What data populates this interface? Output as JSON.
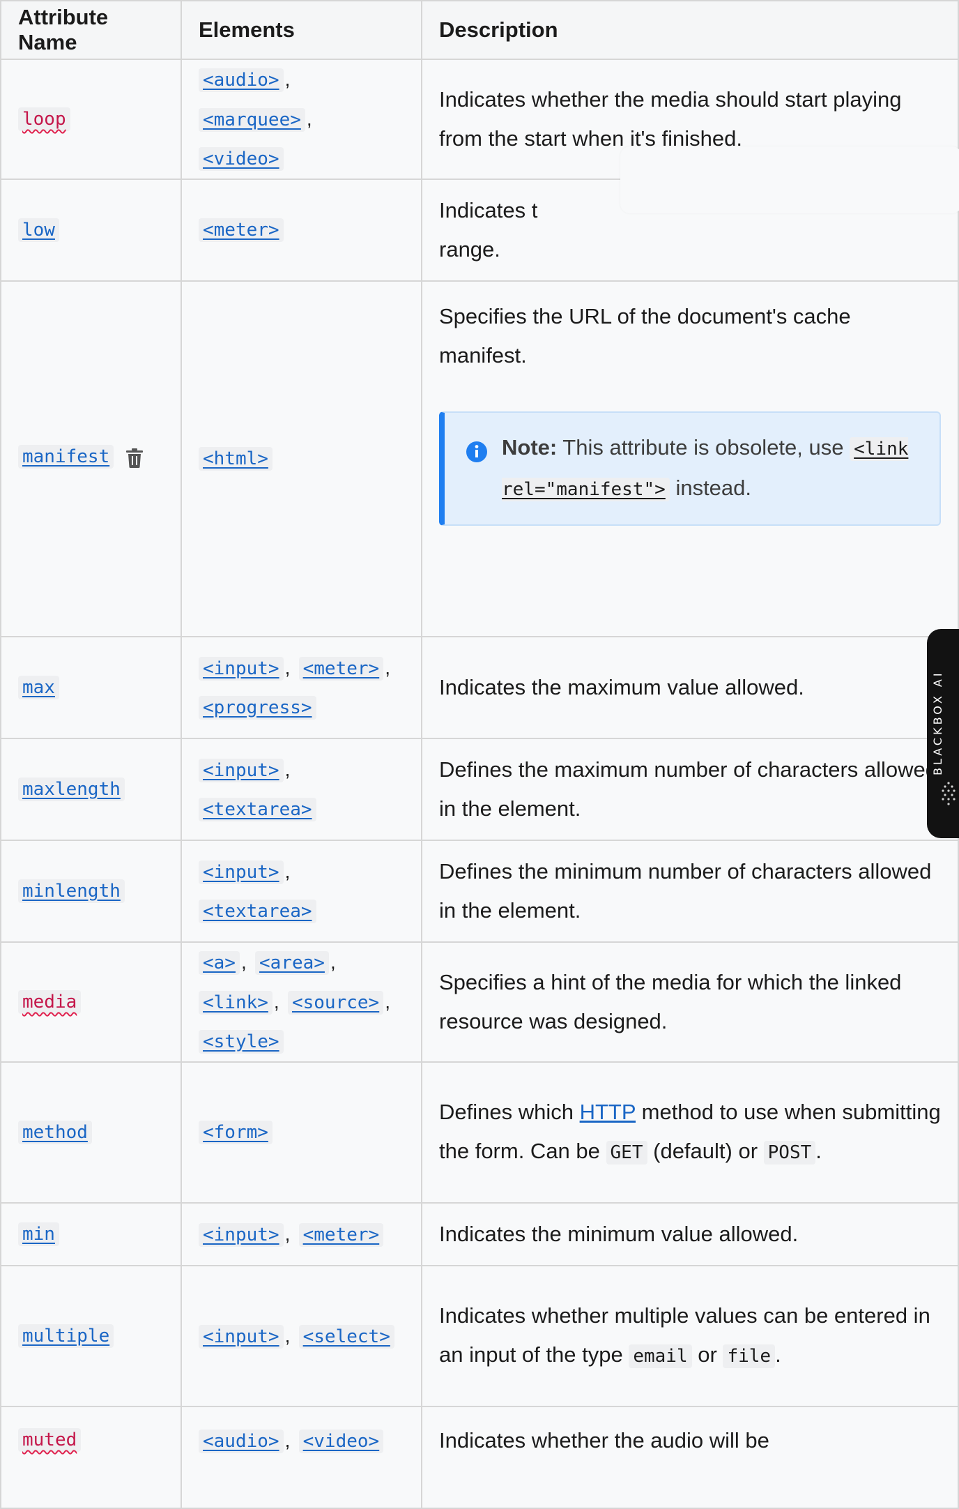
{
  "headers": [
    "Attribute Name",
    "Elements",
    "Description"
  ],
  "rows": [
    {
      "attr": "loop",
      "attr_style": "plain",
      "elements": [
        "<audio>",
        "<marquee>",
        "<video>"
      ],
      "description": "Indicates whether the media should start playing from the start when it's finished."
    },
    {
      "attr": "low",
      "attr_style": "link",
      "elements": [
        "<meter>"
      ],
      "description": "Indicates t",
      "description_tail": "range."
    },
    {
      "attr": "manifest",
      "attr_style": "link",
      "elements": [
        "<html>"
      ],
      "description": "Specifies the URL of the document's cache manifest.",
      "note": {
        "label": "Note:",
        "text_before": "This attribute is obsolete, use",
        "code": "<link rel=\"manifest\">",
        "text_after": "instead."
      }
    },
    {
      "attr": "max",
      "attr_style": "link",
      "elements": [
        "<input>",
        "<meter>",
        "<progress>"
      ],
      "description": "Indicates the maximum value allowed."
    },
    {
      "attr": "maxlength",
      "attr_style": "link",
      "elements": [
        "<input>",
        "<textarea>"
      ],
      "description": "Defines the maximum number of characters allowed in the element."
    },
    {
      "attr": "minlength",
      "attr_style": "link",
      "elements": [
        "<input>",
        "<textarea>"
      ],
      "description": "Defines the minimum number of characters allowed in the element."
    },
    {
      "attr": "media",
      "attr_style": "plain",
      "elements": [
        "<a>",
        "<area>",
        "<link>",
        "<source>",
        "<style>"
      ],
      "description": "Specifies a hint of the media for which the linked resource was designed."
    },
    {
      "attr": "method",
      "attr_style": "link",
      "elements": [
        "<form>"
      ],
      "description_parts": {
        "before": "Defines which",
        "link": "HTTP",
        "middle": "method to use when submitting the form. Can be",
        "code1": "GET",
        "middle2": "(default) or",
        "code2": "POST",
        "after": "."
      }
    },
    {
      "attr": "min",
      "attr_style": "link",
      "elements": [
        "<input>",
        "<meter>"
      ],
      "description": "Indicates the minimum value allowed."
    },
    {
      "attr": "multiple",
      "attr_style": "link",
      "elements": [
        "<input>",
        "<select>"
      ],
      "description_parts": {
        "before": "Indicates whether multiple values can be entered in an input of the type",
        "code1": "email",
        "middle": "or",
        "code2": "file",
        "after": "."
      }
    },
    {
      "attr": "muted",
      "attr_style": "plain",
      "elements": [
        "<audio>",
        "<video>"
      ],
      "description": "Indicates whether the audio will be"
    }
  ],
  "side_tab": {
    "label": "BLACKBOX AI"
  },
  "colors": {
    "link": "#1a66c5",
    "note_bg": "#e3effc",
    "note_border": "#1f7ef0",
    "plain_code": "#c4164a"
  }
}
